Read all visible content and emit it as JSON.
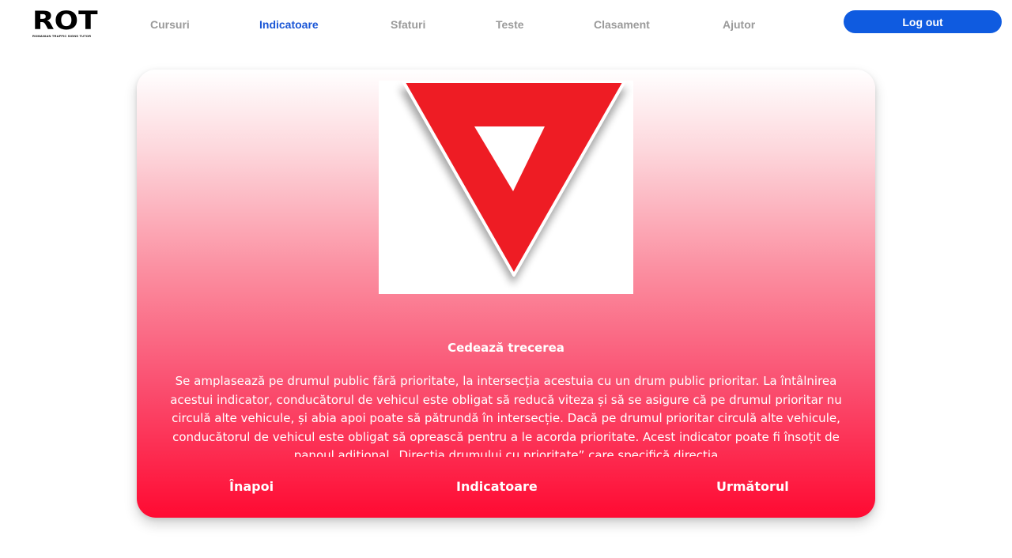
{
  "logo": {
    "text": "ROT",
    "tagline": "ROMANIAN TRAFFIC SIGNS TUTOR"
  },
  "nav": {
    "cursuri": "Cursuri",
    "indicatoare": "Indicatoare",
    "sfaturi": "Sfaturi",
    "teste": "Teste",
    "clasament": "Clasament",
    "ajutor": "Ajutor"
  },
  "header": {
    "logout_label": "Log out"
  },
  "sign": {
    "title": "Cedează trecerea",
    "description": "Se amplasează pe drumul public fără prioritate, la intersecția acestuia cu un drum public prioritar. La întâlnirea acestui indicator, conducătorul de vehicul este obligat să reducă viteza și să se asigure că pe drumul prioritar nu circulă alte vehicule, și abia apoi poate să pătrundă în intersecție. Dacă pe drumul prioritar circulă alte vehicule, conducătorul de vehicul este obligat să oprească pentru a le acorda prioritate. Acest indicator poate fi însoțit de panoul adițional „Direcția drumului cu prioritate” care specifică direcția",
    "image_icon": "yield-sign-icon"
  },
  "card_nav": {
    "back": "Înapoi",
    "index": "Indicatoare",
    "next": "Următorul"
  },
  "colors": {
    "accent": "#0f5be0",
    "sign_red": "#ee1c24",
    "card_bottom": "#ff0a32"
  }
}
